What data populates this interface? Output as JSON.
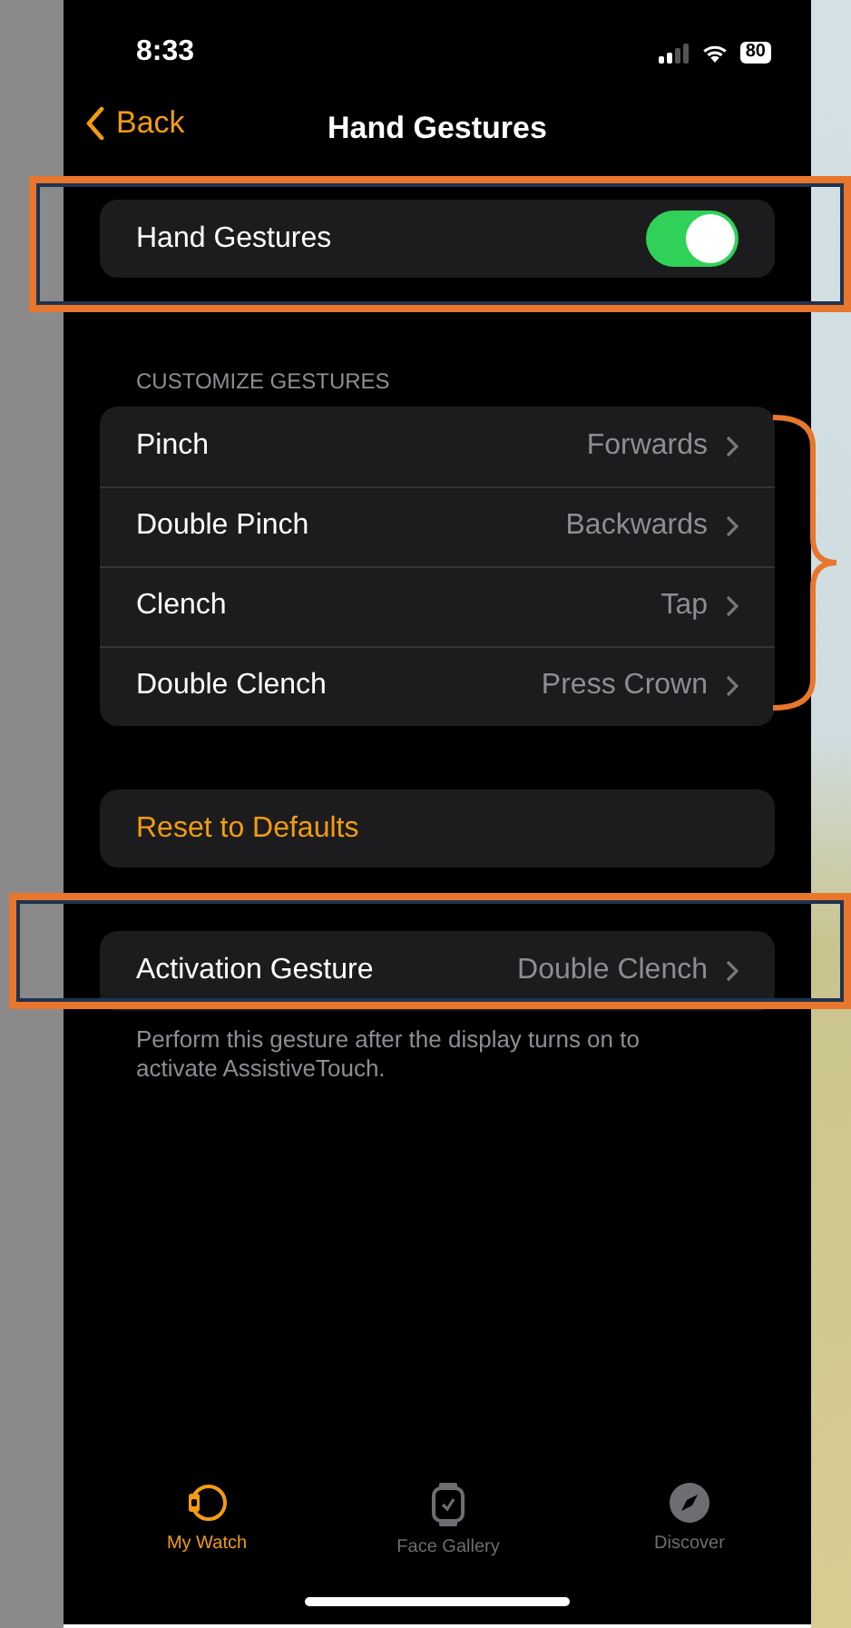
{
  "status_bar": {
    "time": "8:33",
    "battery": "80"
  },
  "nav": {
    "back": "Back",
    "title": "Hand Gestures"
  },
  "toggle": {
    "label": "Hand Gestures",
    "on": true
  },
  "section_header": "CUSTOMIZE GESTURES",
  "gestures": [
    {
      "label": "Pinch",
      "value": "Forwards"
    },
    {
      "label": "Double Pinch",
      "value": "Backwards"
    },
    {
      "label": "Clench",
      "value": "Tap"
    },
    {
      "label": "Double Clench",
      "value": "Press Crown"
    }
  ],
  "reset": "Reset to Defaults",
  "activation": {
    "label": "Activation Gesture",
    "value": "Double Clench"
  },
  "footer": "Perform this gesture after the display turns on to activate AssistiveTouch.",
  "tabs": [
    {
      "kind": "watch",
      "label": "My Watch",
      "selected": true
    },
    {
      "kind": "face",
      "label": "Face Gallery",
      "selected": false
    },
    {
      "kind": "discover",
      "label": "Discover",
      "selected": false
    }
  ]
}
